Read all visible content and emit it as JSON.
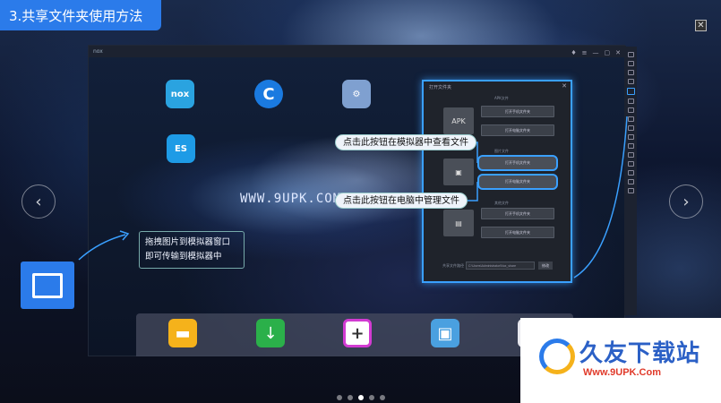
{
  "header": {
    "title": "3.共享文件夹使用方法",
    "close_glyph": "✕"
  },
  "nav": {
    "prev_glyph": "‹",
    "next_glyph": "›"
  },
  "emulator": {
    "window_title": "nox",
    "win_controls": [
      "♦",
      "≡",
      "—",
      "▢",
      "✕"
    ],
    "apps": {
      "nox_label": "nox",
      "browser_label": "C",
      "tools_label": "⚙",
      "es_label": "ES"
    },
    "watermark": "WWW.9UPK.COM",
    "dock": {
      "folder_glyph": "▬",
      "download_glyph": "↓",
      "plus_glyph": "+",
      "gallery_glyph": "▣",
      "calc_glyph": "▦"
    }
  },
  "dialog": {
    "title": "打开文件夹",
    "close_glyph": "✕",
    "sections": {
      "apk_label": "APK文件",
      "image_label": "图片文件",
      "other_label": "其他文件"
    },
    "thumbs": {
      "apk": "APK",
      "image": "▣",
      "doc": "▤"
    },
    "buttons": {
      "apk_phone": "打开手机文件夹",
      "apk_pc": "打开电脑文件夹",
      "img_phone": "打开手机文件夹",
      "img_pc": "打开电脑文件夹",
      "other_phone": "打开手机文件夹",
      "other_pc": "打开电脑文件夹"
    },
    "path_label": "共享文件路径",
    "path_value": "C:\\Users\\Administrator\\Nox_share",
    "path_button": "修改"
  },
  "callouts": {
    "view_in_emulator": "点击此按钮在模拟器中查看文件",
    "manage_on_pc": "点击此按钮在电脑中管理文件"
  },
  "drag_tip": {
    "line1": "拖拽图片到模拟器窗口",
    "line2": "即可传输到模拟器中"
  },
  "pagination": {
    "total": 5,
    "active_index": 2
  },
  "site_logo": {
    "name": "久友下载站",
    "url": "Www.9UPK.Com"
  },
  "colors": {
    "accent": "#2b7bea",
    "highlight": "#3aa0ff",
    "logo_red": "#e03a2a"
  }
}
